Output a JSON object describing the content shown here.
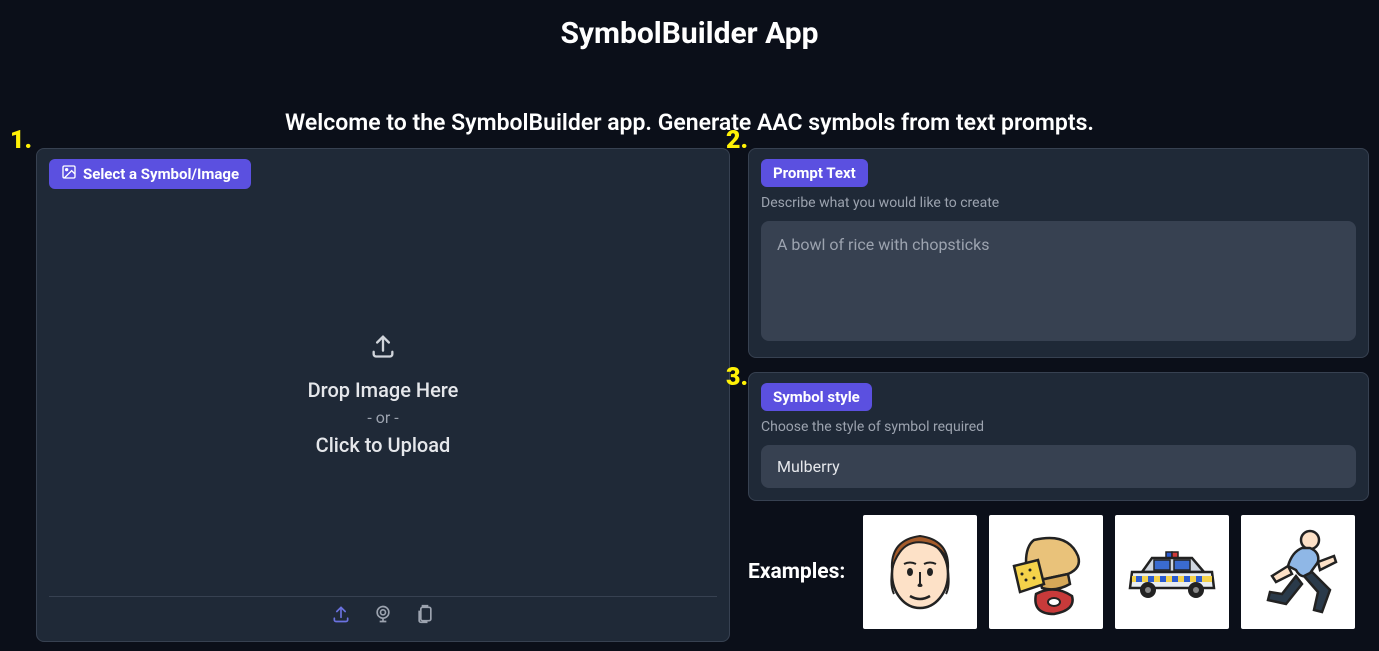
{
  "title": "SymbolBuilder App",
  "subtitle": "Welcome to the SymbolBuilder app. Generate AAC symbols from text prompts.",
  "steps": {
    "one": "1.",
    "two": "2.",
    "three": "3."
  },
  "upload": {
    "badge": "Select a Symbol/Image",
    "drop": "Drop Image Here",
    "or": "- or -",
    "click": "Click to Upload"
  },
  "prompt": {
    "badge": "Prompt Text",
    "helper": "Describe what you would like to create",
    "placeholder": "A bowl of rice with chopsticks"
  },
  "style": {
    "badge": "Symbol style",
    "helper": "Choose the style of symbol required",
    "selected": "Mulberry"
  },
  "examples": {
    "label": "Examples:",
    "items": [
      "face",
      "bread-cheese-meat",
      "police-car",
      "running-person"
    ]
  },
  "icons": {
    "image": "image-icon",
    "upload": "upload-icon",
    "upload_small": "upload-alt-icon",
    "camera": "webcam-icon",
    "clipboard": "clipboard-icon"
  }
}
